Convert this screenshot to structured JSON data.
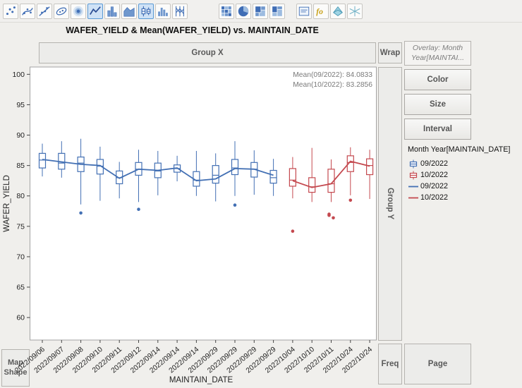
{
  "title": "WAFER_YIELD & Mean(WAFER_YIELD) vs. MAINTAIN_DATE",
  "toolbar": {
    "groups": [
      {
        "icons": [
          {
            "name": "points",
            "selected": false
          },
          {
            "name": "smoother",
            "selected": false
          },
          {
            "name": "line-of-fit",
            "selected": false
          },
          {
            "name": "ellipse",
            "selected": false
          },
          {
            "name": "contour",
            "selected": false
          },
          {
            "name": "line",
            "selected": true
          },
          {
            "name": "bar",
            "selected": false
          },
          {
            "name": "area",
            "selected": false
          },
          {
            "name": "box-plot",
            "selected": true
          },
          {
            "name": "histogram",
            "selected": false
          },
          {
            "name": "parallel",
            "selected": false
          }
        ]
      },
      {
        "icons": [
          {
            "name": "heatmap",
            "selected": false
          },
          {
            "name": "pie",
            "selected": false
          },
          {
            "name": "treemap",
            "selected": false
          },
          {
            "name": "mosaic",
            "selected": false
          }
        ]
      },
      {
        "icons": [
          {
            "name": "caption-box",
            "selected": false
          },
          {
            "name": "formula",
            "selected": false
          },
          {
            "name": "surface-plot",
            "selected": false
          },
          {
            "name": "scatterplot-3d",
            "selected": false
          }
        ]
      }
    ]
  },
  "zones": {
    "group_x": "Group X",
    "wrap": "Wrap",
    "overlay_line1": "Overlay: Month",
    "overlay_line2": "Year[MAINTAI...",
    "color": "Color",
    "size": "Size",
    "interval": "Interval",
    "group_y": "Group Y",
    "freq": "Freq",
    "page": "Page",
    "map_shape": "Map Shape"
  },
  "legend": {
    "title": "Month Year[MAINTAIN_DATE]",
    "entries": [
      {
        "glyph": "box",
        "color": "#4370b4",
        "label": "09/2022"
      },
      {
        "glyph": "box",
        "color": "#c4494f",
        "label": "10/2022"
      },
      {
        "glyph": "line",
        "color": "#4370b4",
        "label": "09/2022"
      },
      {
        "glyph": "line",
        "color": "#c4494f",
        "label": "10/2022"
      }
    ]
  },
  "annotations": [
    "Mean(09/2022): 84.0833",
    "Mean(10/2022): 83.2856"
  ],
  "chart_data": {
    "type": "box",
    "title": "WAFER_YIELD & Mean(WAFER_YIELD) vs. MAINTAIN_DATE",
    "xlabel": "MAINTAIN_DATE",
    "ylabel": "WAFER_YIELD",
    "ylim": [
      56.3,
      101.2
    ],
    "yticks": [
      60,
      65,
      70,
      75,
      80,
      85,
      90,
      95,
      100
    ],
    "groups": {
      "09/2022": "#4370b4",
      "10/2022": "#c4494f"
    },
    "overall_means": {
      "09/2022": 84.0833,
      "10/2022": 83.2856
    },
    "boxes": [
      {
        "date": "2022/09/06",
        "group": "09/2022",
        "low": 83.2,
        "q1": 84.6,
        "median": 85.9,
        "q3": 87.0,
        "high": 88.6,
        "mean": 86.0,
        "outliers": []
      },
      {
        "date": "2022/09/07",
        "group": "09/2022",
        "low": 83.0,
        "q1": 84.4,
        "median": 85.4,
        "q3": 87.0,
        "high": 89.0,
        "mean": 85.6,
        "outliers": []
      },
      {
        "date": "2022/09/08",
        "group": "09/2022",
        "low": 78.6,
        "q1": 84.0,
        "median": 85.4,
        "q3": 86.4,
        "high": 89.4,
        "mean": 85.2,
        "outliers": [
          77.2
        ]
      },
      {
        "date": "2022/09/10",
        "group": "09/2022",
        "low": 79.2,
        "q1": 83.6,
        "median": 84.9,
        "q3": 86.0,
        "high": 88.1,
        "mean": 85.0,
        "outliers": []
      },
      {
        "date": "2022/09/11",
        "group": "09/2022",
        "low": 79.6,
        "q1": 82.0,
        "median": 83.0,
        "q3": 84.1,
        "high": 85.6,
        "mean": 82.9,
        "outliers": []
      },
      {
        "date": "2022/09/12",
        "group": "09/2022",
        "low": 79.0,
        "q1": 83.4,
        "median": 84.4,
        "q3": 85.5,
        "high": 87.6,
        "mean": 84.4,
        "outliers": [
          77.8
        ]
      },
      {
        "date": "2022/09/14",
        "group": "09/2022",
        "low": 80.1,
        "q1": 83.0,
        "median": 84.1,
        "q3": 85.4,
        "high": 87.4,
        "mean": 84.2,
        "outliers": []
      },
      {
        "date": "2022/09/14",
        "group": "09/2022",
        "low": 82.4,
        "q1": 83.9,
        "median": 84.5,
        "q3": 85.1,
        "high": 86.6,
        "mean": 84.6,
        "outliers": []
      },
      {
        "date": "2022/09/14",
        "group": "09/2022",
        "low": 80.0,
        "q1": 81.6,
        "median": 82.6,
        "q3": 84.0,
        "high": 87.4,
        "mean": 82.5,
        "outliers": []
      },
      {
        "date": "2022/09/29",
        "group": "09/2022",
        "low": 79.1,
        "q1": 82.1,
        "median": 83.4,
        "q3": 85.0,
        "high": 87.0,
        "mean": 82.8,
        "outliers": []
      },
      {
        "date": "2022/09/29",
        "group": "09/2022",
        "low": 80.0,
        "q1": 83.5,
        "median": 84.6,
        "q3": 86.0,
        "high": 89.0,
        "mean": 84.5,
        "outliers": [
          78.5
        ]
      },
      {
        "date": "2022/09/29",
        "group": "09/2022",
        "low": 80.2,
        "q1": 83.1,
        "median": 84.4,
        "q3": 85.5,
        "high": 87.5,
        "mean": 84.4,
        "outliers": []
      },
      {
        "date": "2022/09/29",
        "group": "09/2022",
        "low": 80.0,
        "q1": 82.1,
        "median": 83.0,
        "q3": 84.2,
        "high": 86.1,
        "mean": 83.4,
        "outliers": []
      },
      {
        "date": "2022/10/04",
        "group": "10/2022",
        "low": 79.6,
        "q1": 81.6,
        "median": 82.6,
        "q3": 84.5,
        "high": 86.4,
        "mean": 82.5,
        "outliers": [
          74.2
        ]
      },
      {
        "date": "2022/10/10",
        "group": "10/2022",
        "low": 79.0,
        "q1": 80.6,
        "median": 81.5,
        "q3": 83.0,
        "high": 87.9,
        "mean": 81.4,
        "outliers": []
      },
      {
        "date": "2022/10/11",
        "group": "10/2022",
        "low": 79.0,
        "q1": 80.6,
        "median": 82.0,
        "q3": 84.4,
        "high": 86.0,
        "mean": 82.0,
        "outliers": [
          77.0,
          76.4,
          76.8
        ]
      },
      {
        "date": "2022/10/24",
        "group": "10/2022",
        "low": 80.1,
        "q1": 84.0,
        "median": 85.5,
        "q3": 86.6,
        "high": 88.0,
        "mean": 85.7,
        "outliers": [
          79.3
        ]
      },
      {
        "date": "2022/10/24",
        "group": "10/2022",
        "low": 79.5,
        "q1": 83.5,
        "median": 85.0,
        "q3": 86.1,
        "high": 87.6,
        "mean": 84.9,
        "outliers": []
      }
    ]
  }
}
